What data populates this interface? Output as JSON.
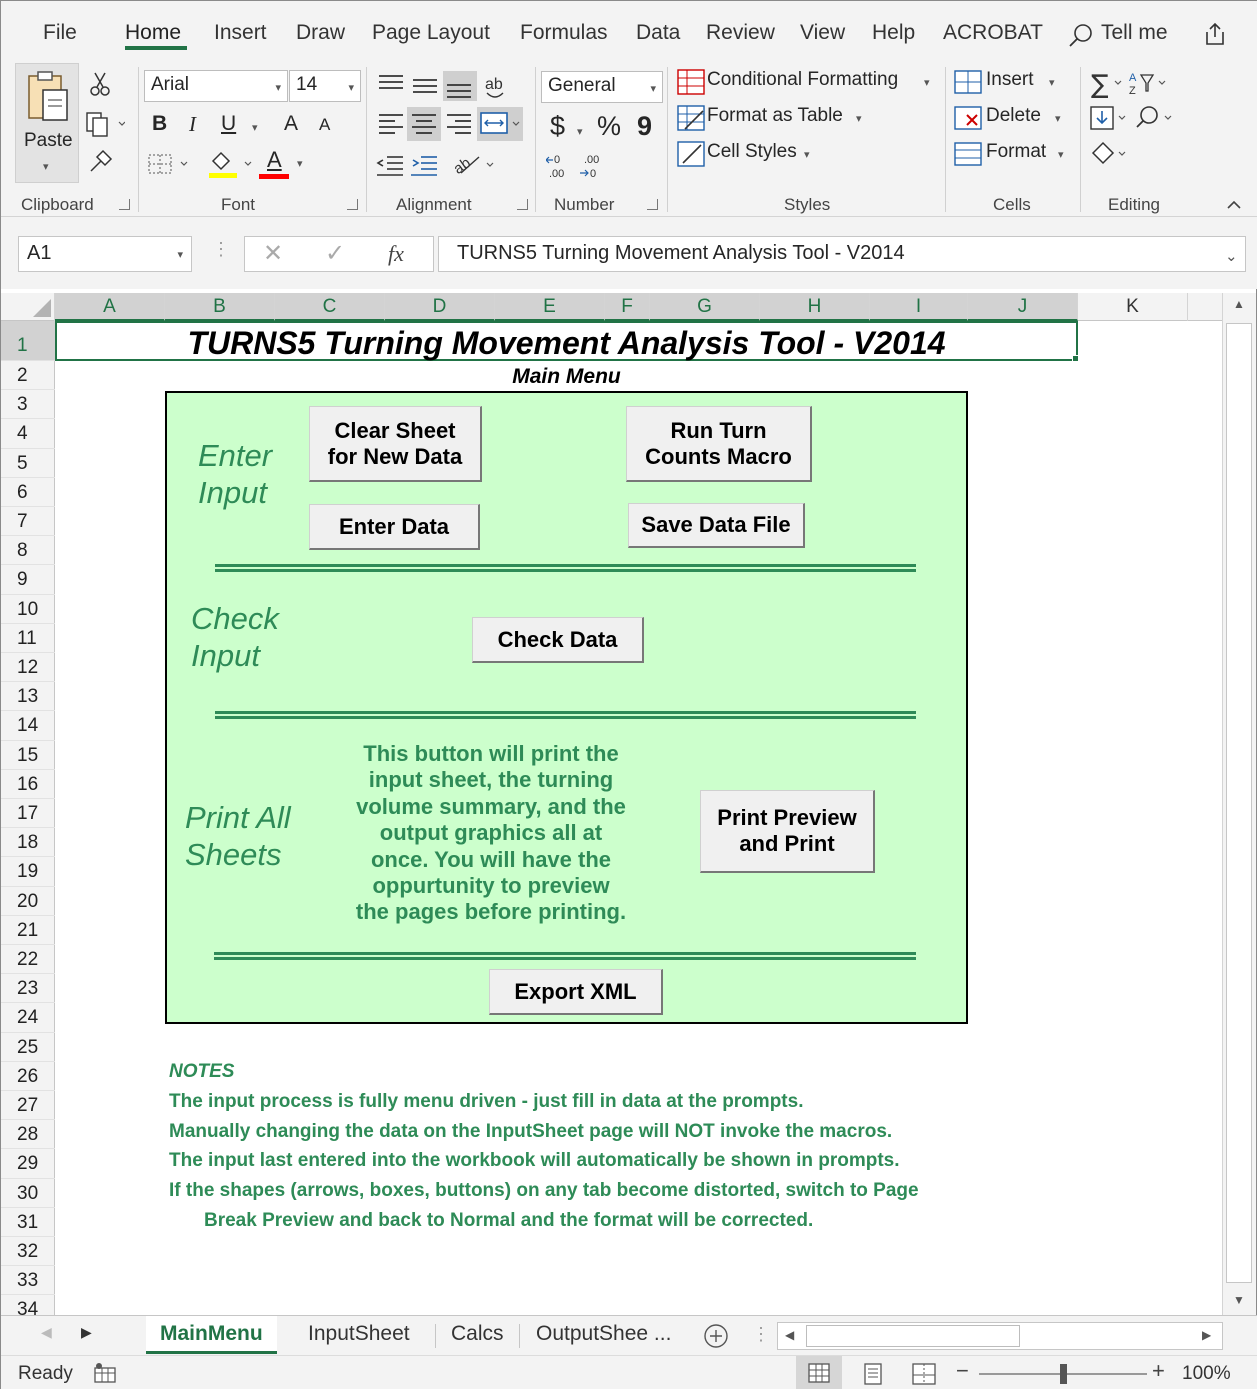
{
  "menu": {
    "tabs": [
      "File",
      "Home",
      "Insert",
      "Draw",
      "Page Layout",
      "Formulas",
      "Data",
      "Review",
      "View",
      "Help",
      "ACROBAT"
    ],
    "active_tab": "Home",
    "tell_me": "Tell me"
  },
  "ribbon": {
    "clipboard": {
      "label": "Clipboard",
      "paste": "Paste"
    },
    "font": {
      "label": "Font",
      "name": "Arial",
      "size": "14",
      "bold": "B",
      "italic": "I",
      "underline": "U",
      "grow": "A",
      "shrink": "A",
      "font_color_letter": "A"
    },
    "alignment": {
      "label": "Alignment"
    },
    "number": {
      "label": "Number",
      "format": "General",
      "currency": "$",
      "percent": "%",
      "comma": "9"
    },
    "styles": {
      "label": "Styles",
      "conditional": "Conditional Formatting",
      "format_table": "Format as Table",
      "cell_styles": "Cell Styles"
    },
    "cells": {
      "label": "Cells",
      "insert": "Insert",
      "delete": "Delete",
      "format": "Format"
    },
    "editing": {
      "label": "Editing"
    },
    "accent_color": "#217346"
  },
  "formula_bar": {
    "name_box": "A1",
    "fx": "fx",
    "content": "TURNS5 Turning Movement Analysis Tool - V2014"
  },
  "columns": [
    "A",
    "B",
    "C",
    "D",
    "E",
    "F",
    "G",
    "H",
    "I",
    "J",
    "K"
  ],
  "rows": [
    "1",
    "2",
    "3",
    "4",
    "5",
    "6",
    "7",
    "8",
    "9",
    "10",
    "11",
    "12",
    "13",
    "14",
    "15",
    "16",
    "17",
    "18",
    "19",
    "20",
    "21",
    "22",
    "23",
    "24",
    "25",
    "26",
    "27",
    "28",
    "29",
    "30",
    "31",
    "32",
    "33",
    "34"
  ],
  "sheet": {
    "title": "TURNS5 Turning Movement Analysis Tool - V2014",
    "subtitle": "Main Menu",
    "panel_color": "#ccffcc",
    "label_color": "#2e8b57",
    "sections": {
      "enter": [
        "Enter",
        "Input"
      ],
      "check": [
        "Check",
        "Input"
      ],
      "print": [
        "Print All",
        "Sheets"
      ]
    },
    "buttons": {
      "clear": [
        "Clear Sheet",
        "for New Data"
      ],
      "run": [
        "Run Turn",
        "Counts Macro"
      ],
      "enter_data": "Enter Data",
      "save": "Save Data File",
      "check": "Check Data",
      "print": [
        "Print Preview",
        "and Print"
      ],
      "export": "Export XML"
    },
    "print_description": [
      "This button will print the",
      "input sheet, the turning",
      "volume summary, and the",
      "output graphics all at",
      "once. You will have the",
      "oppurtunity to preview",
      "the pages before printing."
    ],
    "notes": {
      "heading": "NOTES",
      "lines": [
        "The input process is fully menu driven - just fill in data at the prompts.",
        "Manually changing the data on the InputSheet page will NOT invoke the macros.",
        "The input last entered into the workbook will automatically be shown in prompts.",
        "If the shapes (arrows, boxes, buttons) on any tab become distorted, switch to Page",
        "Break Preview and back to Normal and the format will be corrected."
      ]
    }
  },
  "sheet_tabs": [
    "MainMenu",
    "InputSheet",
    "Calcs",
    "OutputShee ..."
  ],
  "active_sheet": "MainMenu",
  "status": {
    "text": "Ready",
    "zoom": "100%",
    "zoom_level_percent": 100
  }
}
